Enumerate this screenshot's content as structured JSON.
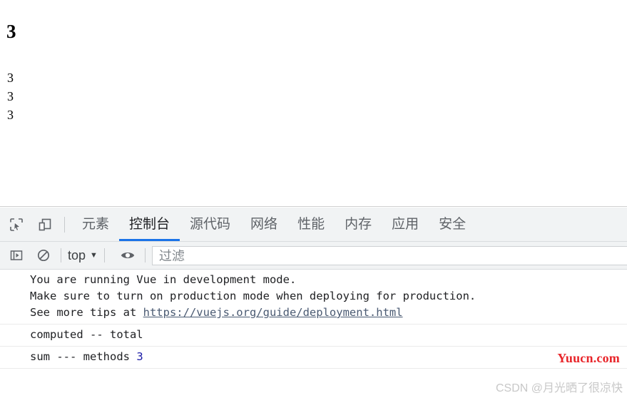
{
  "page": {
    "heading": "3",
    "values": [
      "3",
      "3",
      "3"
    ]
  },
  "devtools": {
    "icons": {
      "inspect": "inspect-element-icon",
      "device": "device-toolbar-icon",
      "sidebar": "console-sidebar-icon",
      "clear": "clear-console-icon",
      "eye": "live-expression-eye-icon",
      "caret": "chevron-down-icon"
    },
    "tabs": [
      {
        "label": "元素",
        "active": false
      },
      {
        "label": "控制台",
        "active": true
      },
      {
        "label": "源代码",
        "active": false
      },
      {
        "label": "网络",
        "active": false
      },
      {
        "label": "性能",
        "active": false
      },
      {
        "label": "内存",
        "active": false
      },
      {
        "label": "应用",
        "active": false
      },
      {
        "label": "安全",
        "active": false
      }
    ],
    "toolbar": {
      "context_value": "top",
      "caret": "▼",
      "filter_placeholder": "过滤"
    },
    "console": {
      "groups": [
        {
          "lines": [
            {
              "text": "You are running Vue in development mode."
            },
            {
              "text": "Make sure to turn on production mode when deploying for production."
            },
            {
              "prefix": "See more tips at ",
              "link": "https://vuejs.org/guide/deployment.html"
            }
          ]
        },
        {
          "lines": [
            {
              "text": "computed -- total"
            }
          ]
        },
        {
          "lines": [
            {
              "prefix": "sum --- methods ",
              "number": "3"
            }
          ]
        }
      ]
    }
  },
  "watermarks": {
    "yuucn": "Yuucn.com",
    "csdn": "CSDN @月光晒了很凉快"
  },
  "colors": {
    "accent_blue": "#1a73e8",
    "panel_bg": "#f1f3f4",
    "watermark_red": "#e8252a",
    "number_token": "#1a1aa6"
  }
}
